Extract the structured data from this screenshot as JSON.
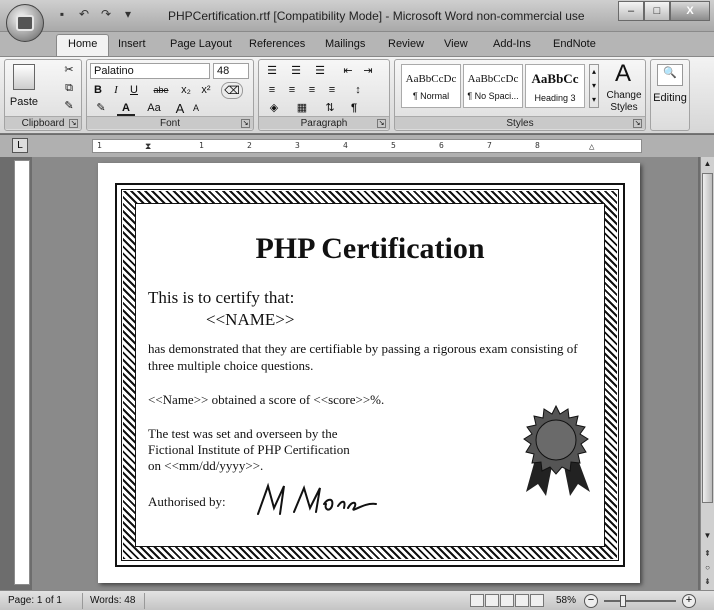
{
  "window": {
    "title": "PHPCertification.rtf [Compatibility Mode] - Microsoft Word non-commercial use",
    "minimize": "–",
    "maximize": "□",
    "close": "X"
  },
  "ribbon_tabs": [
    "Home",
    "Insert",
    "Page Layout",
    "References",
    "Mailings",
    "Review",
    "View",
    "Add-Ins",
    "EndNote"
  ],
  "active_tab": "Home",
  "clipboard": {
    "label": "Clipboard",
    "paste": "Paste"
  },
  "font": {
    "label": "Font",
    "family": "Palatino",
    "size": "48",
    "bold": "B",
    "italic": "I",
    "underline": "U",
    "strike": "abe",
    "subscript": "x₂",
    "superscript": "x²",
    "grow": "A",
    "shrink": "A",
    "change_case": "Aa"
  },
  "paragraph": {
    "label": "Paragraph"
  },
  "styles": {
    "label": "Styles",
    "items": [
      {
        "sample": "AaBbCcDc",
        "name": "¶ Normal"
      },
      {
        "sample": "AaBbCcDc",
        "name": "¶ No Spaci..."
      },
      {
        "sample": "AaBbCc",
        "name": "Heading 3"
      }
    ],
    "change_styles": "Change Styles"
  },
  "editing": {
    "label": "Editing"
  },
  "certificate": {
    "title": "PHP Certification",
    "certify": "This is to certify that:",
    "name_field": "<<NAME>>",
    "demonstrated": "has demonstrated that they are certifiable by passing a rigorous exam consisting of three multiple choice questions.",
    "score": "<<Name>> obtained a score of <<score>>%.",
    "test_line1": "The test was set and overseen by the",
    "test_line2": "Fictional Institute of PHP Certification",
    "test_line3": "on <<mm/dd/yyyy>>.",
    "authorised": "Authorised by:",
    "signature": "M. Moose"
  },
  "statusbar": {
    "page": "Page: 1 of 1",
    "words": "Words: 48",
    "zoom": "58%",
    "zoom_level": 0.58
  },
  "ruler_marks": [
    "1",
    "1",
    "2",
    "3",
    "4",
    "5",
    "6",
    "7",
    "8"
  ]
}
